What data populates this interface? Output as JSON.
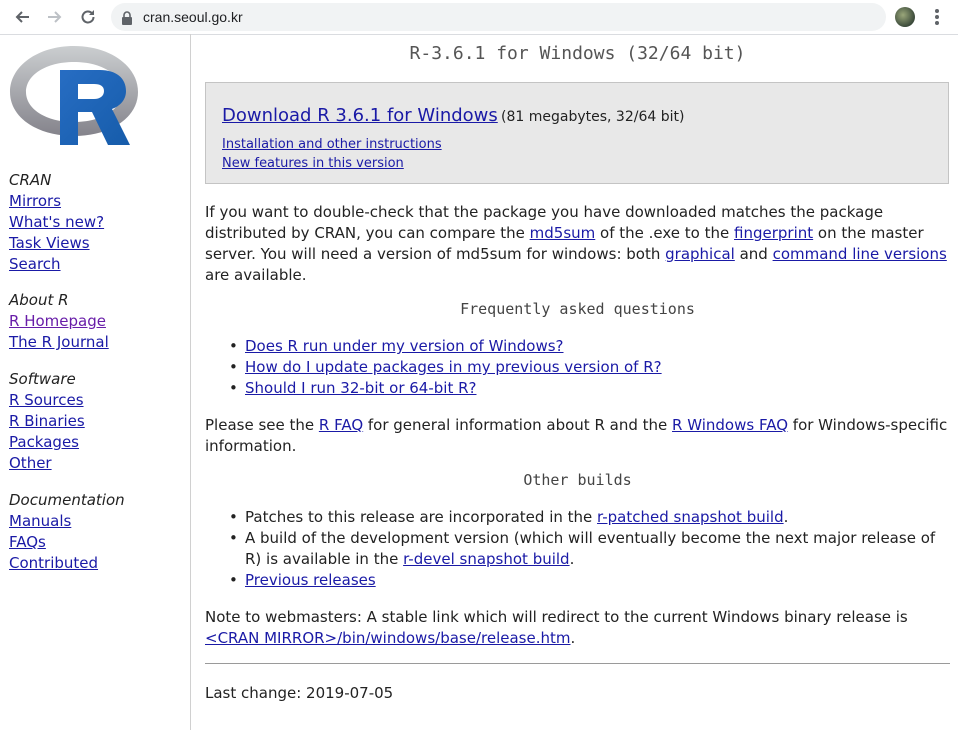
{
  "browser": {
    "url": "cran.seoul.go.kr",
    "icons": [
      "back-icon",
      "forward-icon",
      "reload-icon",
      "lock-icon",
      "star-icon",
      "avatar",
      "menu-icon"
    ]
  },
  "logo": {
    "letter": "R"
  },
  "sidebar": {
    "groups": [
      {
        "heading": "CRAN",
        "links": [
          "Mirrors",
          "What's new?",
          "Task Views",
          "Search"
        ]
      },
      {
        "heading": "About R",
        "links": [
          "R Homepage",
          "The R Journal"
        ]
      },
      {
        "heading": "Software",
        "links": [
          "R Sources",
          "R Binaries",
          "Packages",
          "Other"
        ]
      },
      {
        "heading": "Documentation",
        "links": [
          "Manuals",
          "FAQs",
          "Contributed"
        ]
      }
    ]
  },
  "main": {
    "title": "R-3.6.1 for Windows (32/64 bit)",
    "download": {
      "link": "Download R 3.6.1 for Windows",
      "meta": "(81 megabytes, 32/64 bit)",
      "install": "Installation and other instructions",
      "features": "New features in this version"
    },
    "check": {
      "t1": "If you want to double-check that the package you have downloaded matches the package distributed by CRAN, you can compare the ",
      "l1": "md5sum",
      "t2": " of the .exe to the ",
      "l2": "fingerprint",
      "t3": " on the master server. You will need a version of md5sum for windows: both ",
      "l3": "graphical",
      "t4": " and ",
      "l4": "command line versions",
      "t5": " are available."
    },
    "faq_heading": "Frequently asked questions",
    "faq": [
      "Does R run under my version of Windows?",
      "How do I update packages in my previous version of R?",
      "Should I run 32-bit or 64-bit R?"
    ],
    "see": {
      "t1": "Please see the ",
      "l1": "R FAQ",
      "t2": " for general information about R and the ",
      "l2": "R Windows FAQ",
      "t3": " for Windows-specific information."
    },
    "other_heading": "Other builds",
    "other": {
      "b1_t": "Patches to this release are incorporated in the ",
      "b1_l": "r-patched snapshot build",
      "b1_e": ".",
      "b2_t": "A build of the development version (which will eventually become the next major release of R) is available in the ",
      "b2_l": "r-devel snapshot build",
      "b2_e": ".",
      "b3_l": "Previous releases"
    },
    "note": {
      "t1": "Note to webmasters: A stable link which will redirect to the current Windows binary release is ",
      "l1": "<CRAN MIRROR>/bin/windows/base/release.htm",
      "t2": "."
    },
    "last_change": "Last change: 2019-07-05"
  }
}
